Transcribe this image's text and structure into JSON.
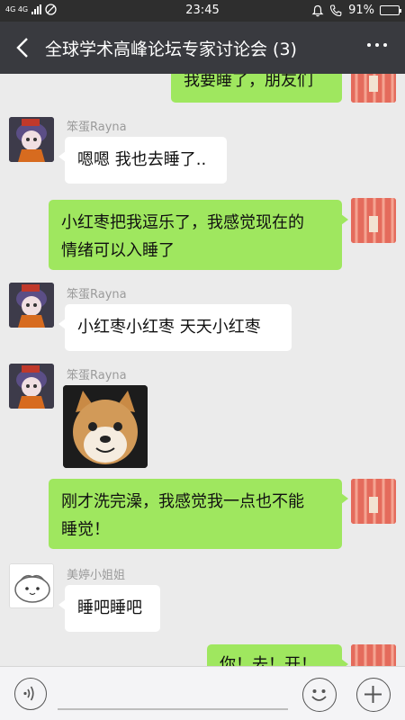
{
  "status_bar": {
    "network": "4G 4G",
    "time": "23:45",
    "battery_percent": "91%",
    "battery_level": 0.91
  },
  "header": {
    "title": "全球学术高峰论坛专家讨论会 (3)"
  },
  "messages": [
    {
      "side": "right",
      "text": "我要睡了，朋友们"
    },
    {
      "side": "left",
      "sender": "笨蛋Rayna",
      "text": "嗯嗯 我也去睡了.."
    },
    {
      "side": "right",
      "text_lines": [
        "小红枣把我逗乐了，我感觉现在的",
        "情绪可以入睡了"
      ]
    },
    {
      "side": "left",
      "sender": "笨蛋Rayna",
      "text": "小红枣小红枣 天天小红枣"
    },
    {
      "side": "left",
      "sender": "笨蛋Rayna",
      "sticker": "shiba-dog-sticker"
    },
    {
      "side": "right",
      "text_lines": [
        "刚才洗完澡，我感觉我一点也不能",
        "睡觉！"
      ]
    },
    {
      "side": "left",
      "sender": "美婷小姐姐",
      "text": "睡吧睡吧"
    },
    {
      "side": "right",
      "text": "你！去！开！"
    }
  ],
  "icons": {
    "back": "chevron-left-icon",
    "more": "more-dots-icon",
    "voice": "voice-icon",
    "emoji": "emoji-icon",
    "plus": "plus-icon"
  },
  "colors": {
    "header_bg": "#393a3f",
    "status_bg": "#2e2e2e",
    "chat_bg": "#ebebeb",
    "own_bubble": "#9fe75f",
    "other_bubble": "#ffffff"
  }
}
